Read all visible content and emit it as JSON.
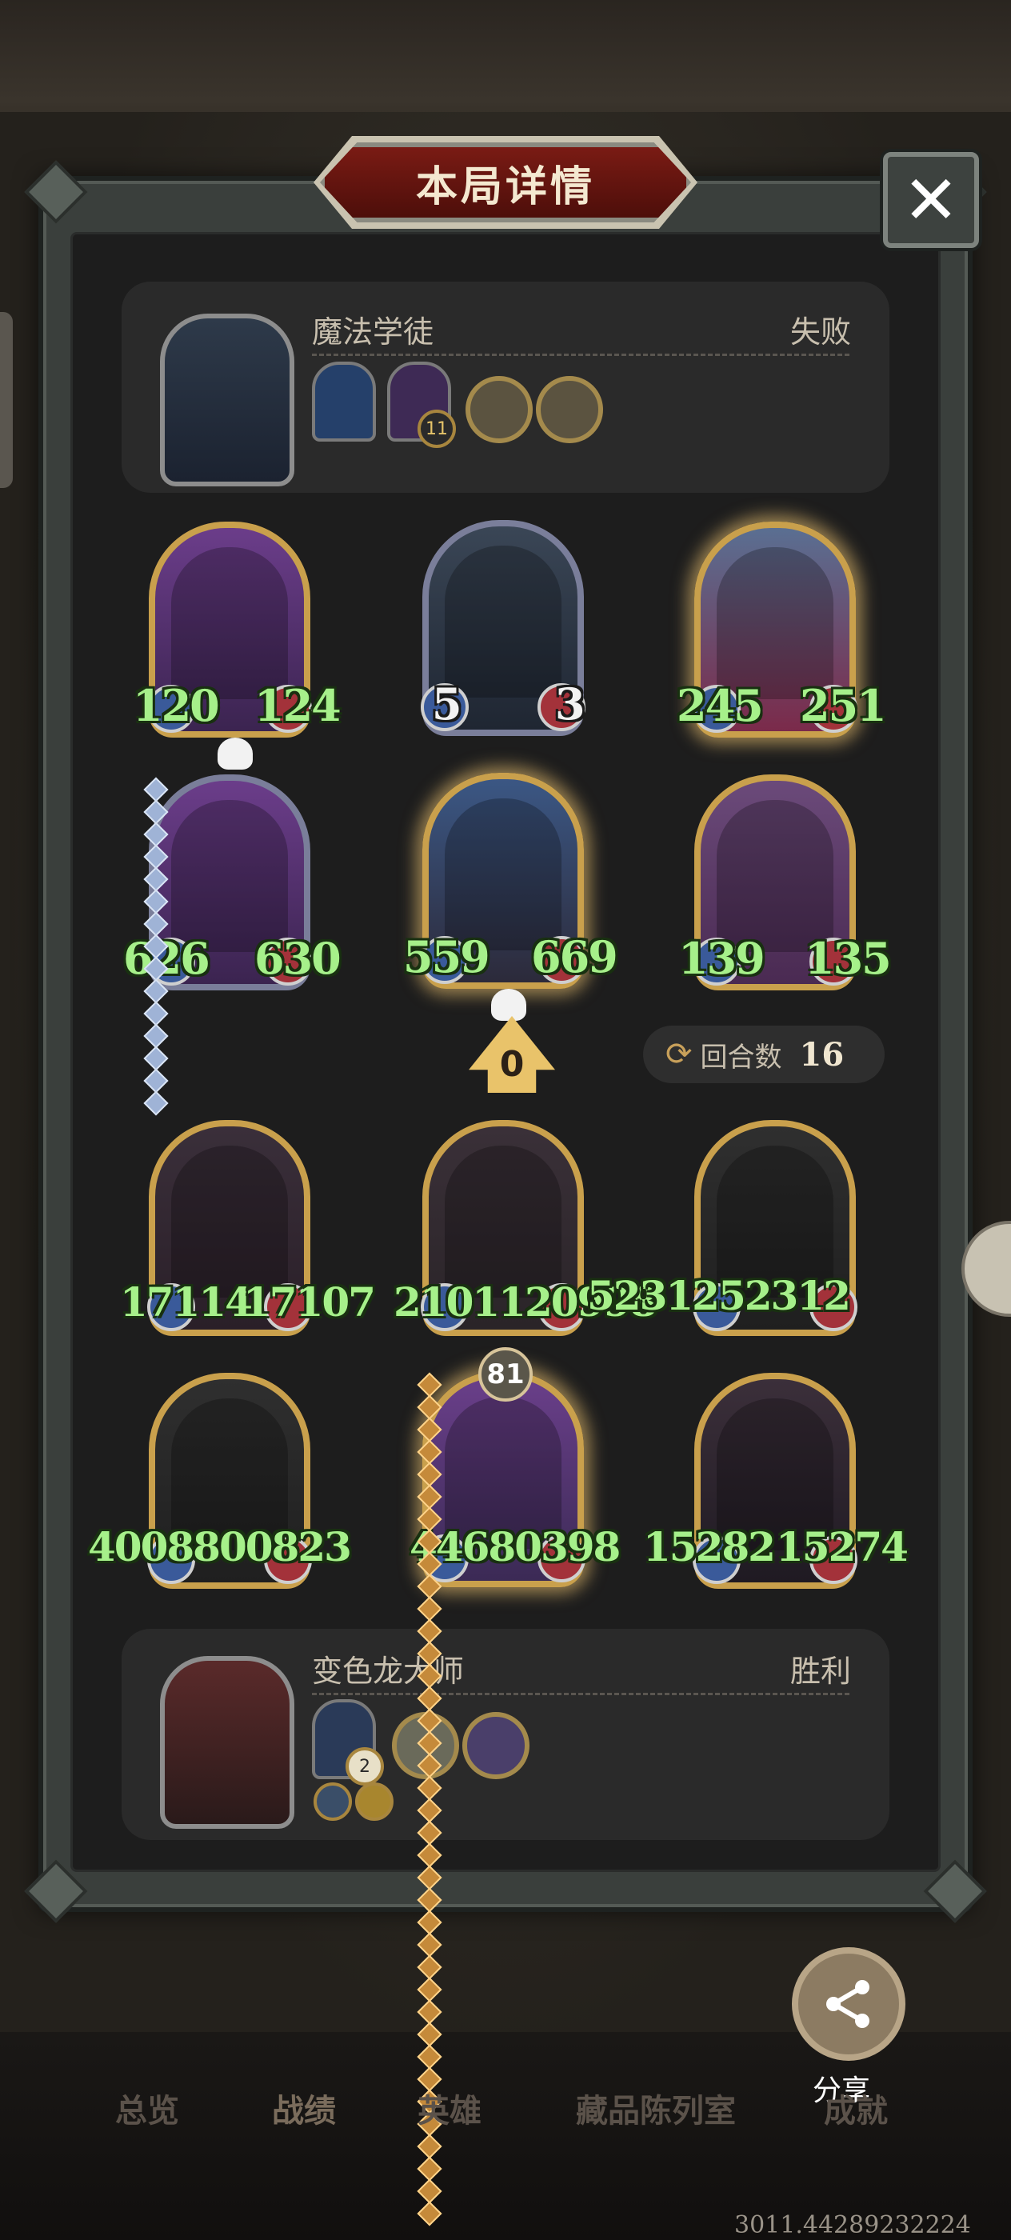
{
  "title": "本局详情",
  "close_symbol": "✕",
  "top_player": {
    "name": "魔法学徒",
    "result": "失败",
    "item_badge": "11"
  },
  "bottom_player": {
    "name": "变色龙大师",
    "result": "胜利",
    "item_badge": "2"
  },
  "cards": [
    {
      "atk": "120",
      "hp": "124",
      "skull": true
    },
    {
      "atk": "5",
      "hp": "3"
    },
    {
      "atk": "245",
      "hp": "251"
    },
    {
      "atk": "626",
      "hp": "630"
    },
    {
      "atk": "559",
      "hp": "669",
      "skull": true
    },
    {
      "atk": "139",
      "hp": "135"
    },
    {
      "atk": "17114",
      "hp": "17107"
    },
    {
      "atk": "2101120998",
      "hp": "5231252312"
    },
    {
      "atk": "4008800823",
      "hp": "44680398"
    },
    {
      "atk": "15282",
      "hp": "15274"
    }
  ],
  "counter": "0",
  "rounds": {
    "label": "回合数",
    "value": "16",
    "icon": "⟳"
  },
  "badge_81": "81",
  "share": {
    "label": "分享",
    "icon": "share-icon"
  },
  "nav": [
    "总览",
    "战绩",
    "英雄",
    "藏品陈列室",
    "成就"
  ],
  "watermark": "3011.44289232224"
}
